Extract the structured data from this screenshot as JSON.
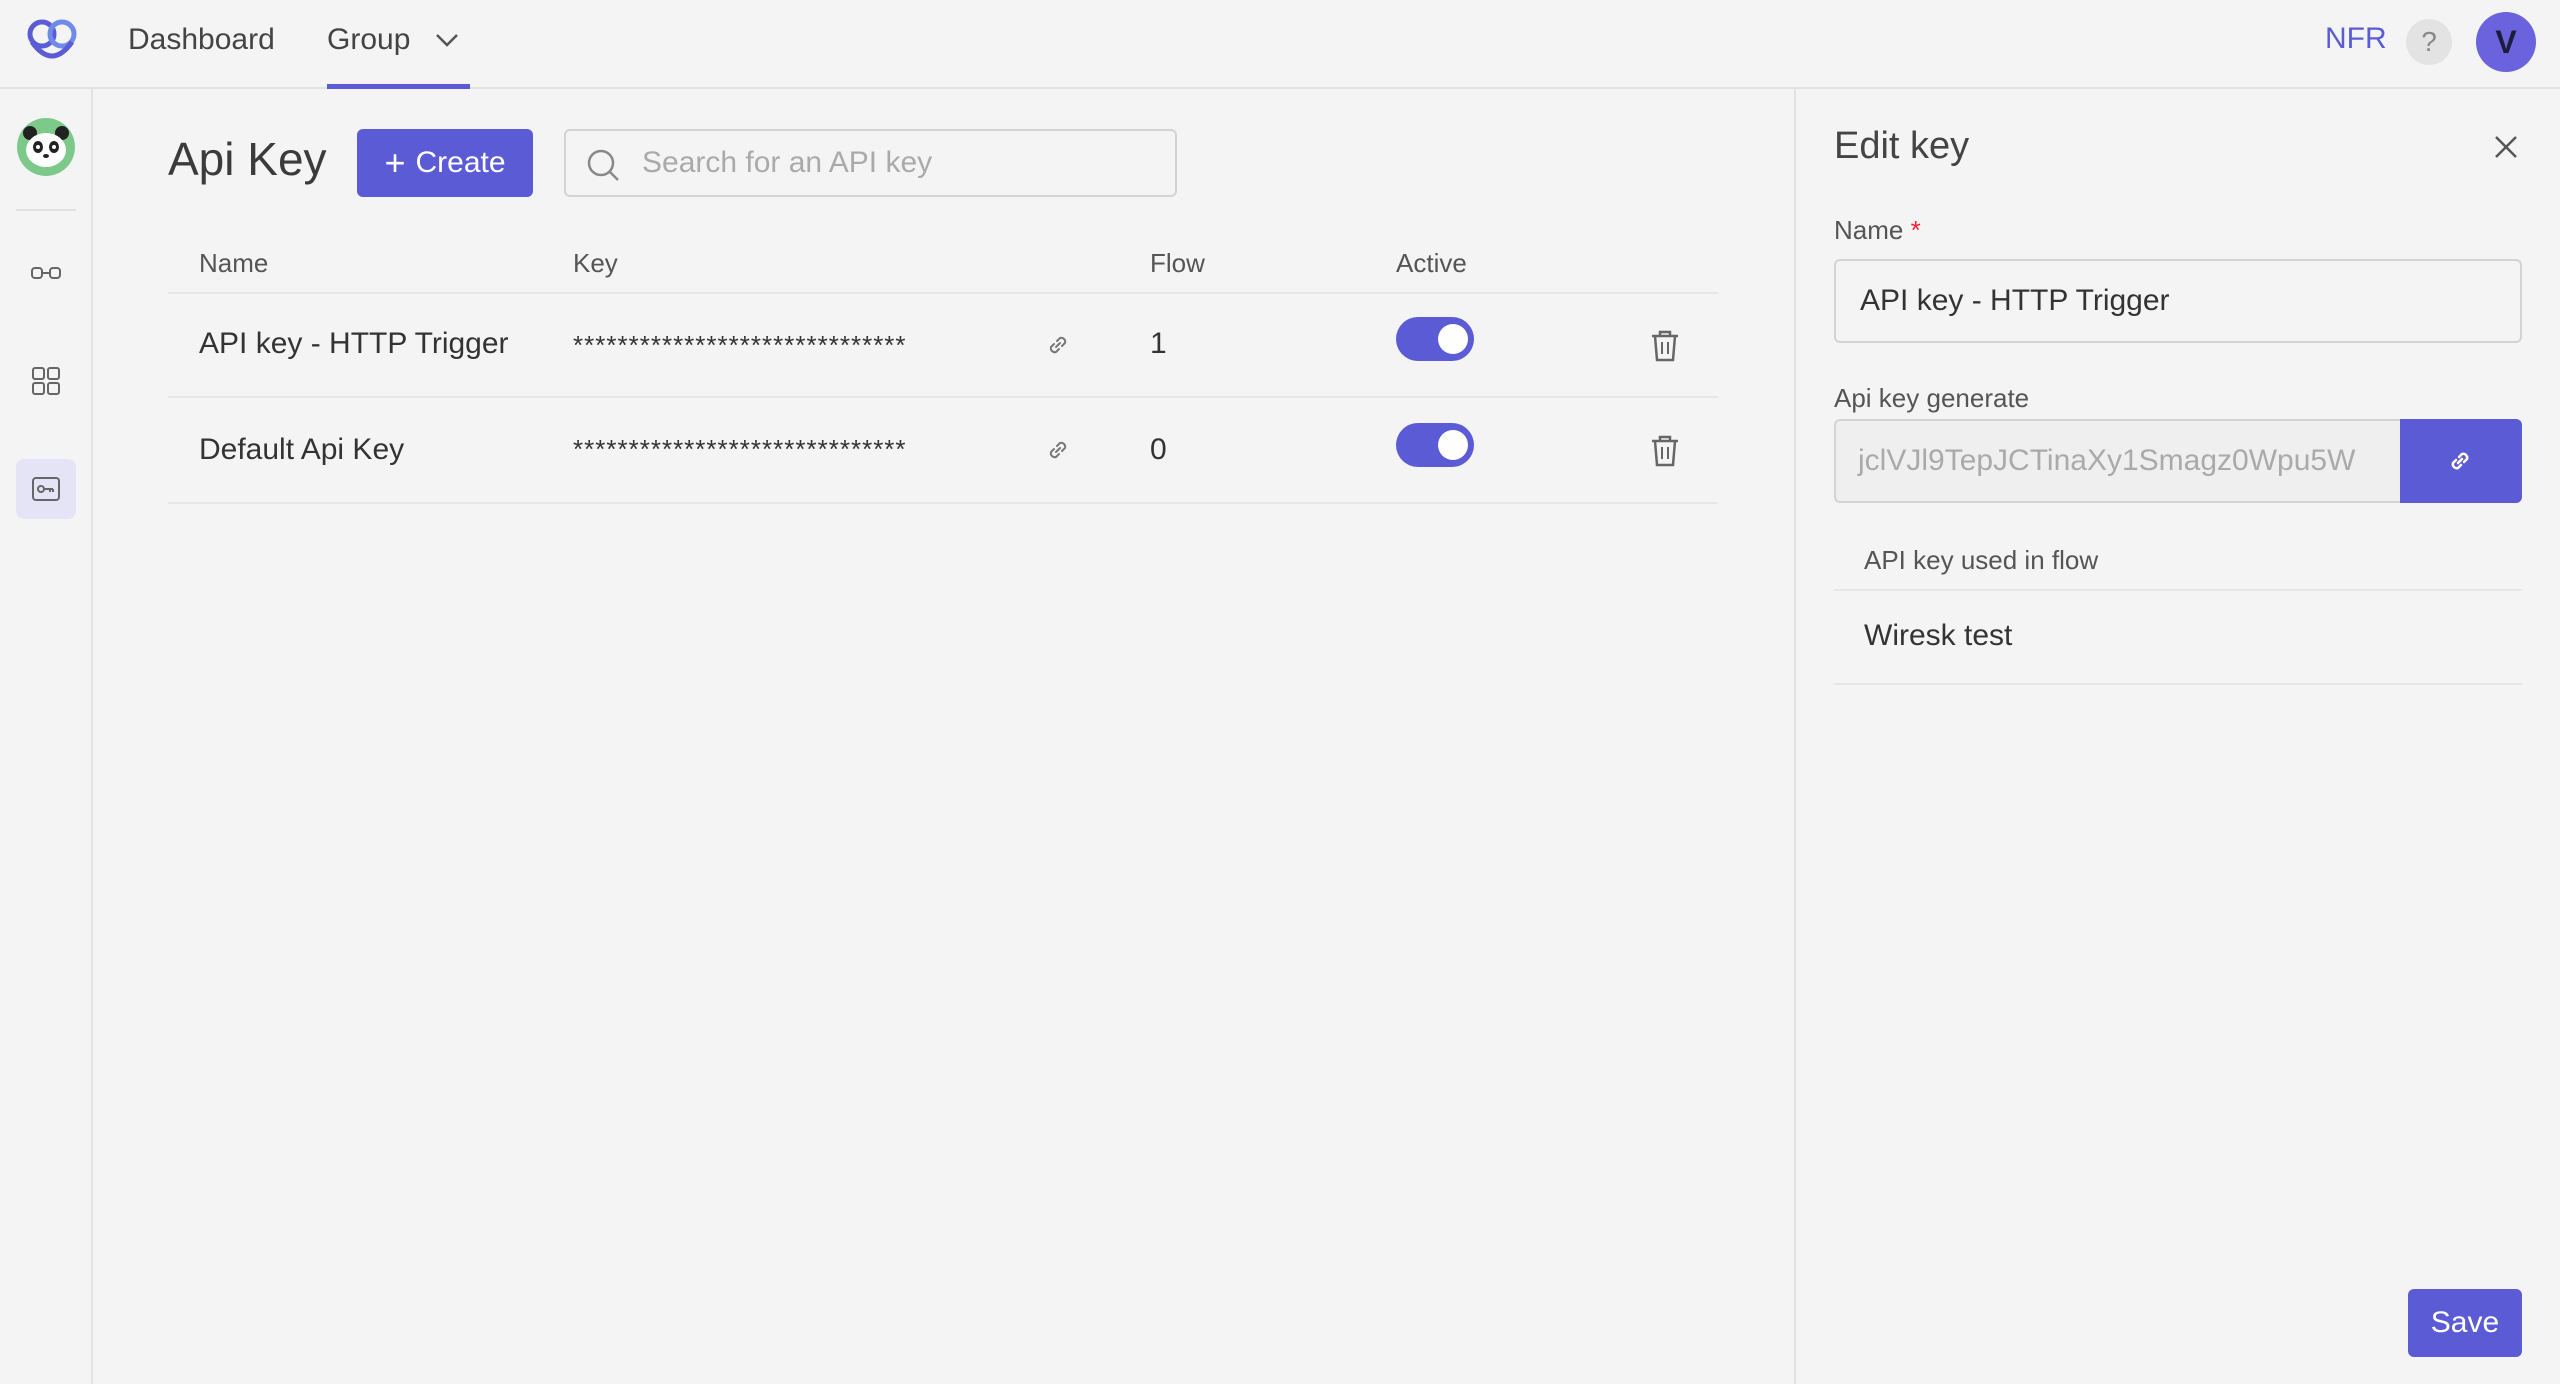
{
  "topbar": {
    "nav": [
      {
        "label": "Dashboard"
      },
      {
        "label": "Group"
      }
    ],
    "org": "NFR",
    "help": "?",
    "user_initial": "V"
  },
  "main": {
    "title": "Api Key",
    "create_label": "Create",
    "search_placeholder": "Search for an API key",
    "columns": {
      "name": "Name",
      "key": "Key",
      "flow": "Flow",
      "active": "Active"
    },
    "rows": [
      {
        "name": "API key - HTTP Trigger",
        "key": "******************************",
        "flow": "1",
        "active": true
      },
      {
        "name": "Default Api Key",
        "key": "******************************",
        "flow": "0",
        "active": true
      }
    ]
  },
  "panel": {
    "title": "Edit key",
    "name_label": "Name",
    "required_mark": "*",
    "name_value": "API key - HTTP Trigger",
    "generate_label": "Api key generate",
    "generated_key": "jclVJl9TepJCTinaXy1Smagz0Wpu5W",
    "used_in_flow_header": "API key used in flow",
    "used_in_flow": [
      "Wiresk test"
    ],
    "save_label": "Save"
  },
  "colors": {
    "accent": "#5b5bd6",
    "background": "#f4f4f4",
    "required": "#ee2233"
  },
  "icons": [
    "logo-icon",
    "chevron-down-icon",
    "panda-avatar-icon",
    "link-nodes-icon",
    "grid-icon",
    "key-icon",
    "search-icon",
    "link-icon",
    "trash-icon",
    "close-icon"
  ]
}
